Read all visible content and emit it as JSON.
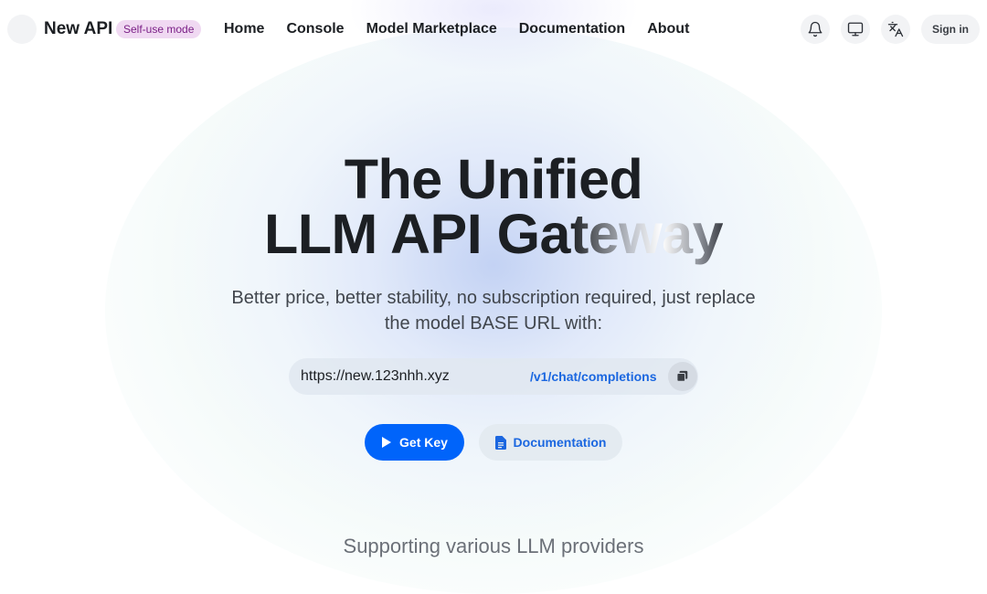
{
  "header": {
    "app_name": "New API",
    "mode_badge": "Self-use mode",
    "nav": [
      {
        "label": "Home"
      },
      {
        "label": "Console"
      },
      {
        "label": "Model Marketplace"
      },
      {
        "label": "Documentation"
      },
      {
        "label": "About"
      }
    ],
    "icons": [
      "bell-icon",
      "monitor-icon",
      "translate-icon"
    ],
    "sign_in_label": "Sign in"
  },
  "hero": {
    "title_line1": "The Unified",
    "title_line2_plain": "LLM API Ga",
    "title_line2_shine": "teway",
    "subtitle": "Better price, better stability, no subscription required, just replace the model BASE URL with:",
    "base_url": "https://new.123nhh.xyz",
    "endpoint_path": "/v1/chat/completions",
    "get_key_label": "Get Key",
    "docs_label": "Documentation"
  },
  "providers_heading": "Supporting various LLM providers",
  "colors": {
    "primary": "#0064fa",
    "link": "#1b67e0",
    "badge_bg": "#f0d9f2",
    "badge_text": "#7a1f86"
  }
}
